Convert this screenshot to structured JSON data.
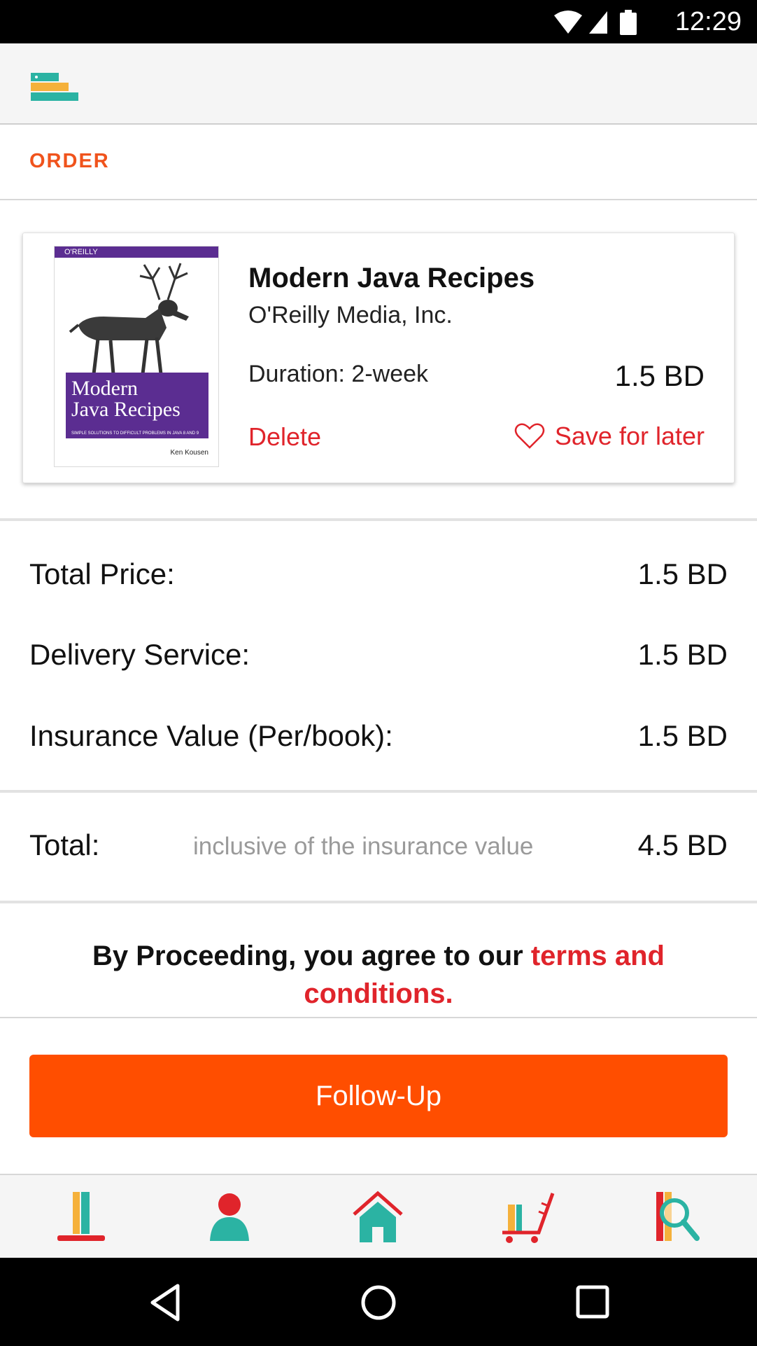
{
  "status_bar": {
    "time": "12:29",
    "icons": [
      "wifi-icon",
      "cell-signal-icon",
      "battery-icon"
    ]
  },
  "app_bar": {
    "menu_icon": "menu-stack-icon"
  },
  "section": {
    "title": "ORDER"
  },
  "order_item": {
    "cover": {
      "brand": "O'REILLY",
      "title_line1": "Modern",
      "title_line2": "Java Recipes",
      "subtitle": "SIMPLE SOLUTIONS TO DIFFICULT PROBLEMS IN JAVA 8 AND 9",
      "author": "Ken Kousen"
    },
    "title": "Modern Java Recipes",
    "publisher": "O'Reilly Media, Inc.",
    "duration": "Duration: 2-week",
    "price": "1.5 BD",
    "delete_label": "Delete",
    "save_label": "Save for later"
  },
  "summary": {
    "total_price_label": "Total Price:",
    "total_price_value": "1.5 BD",
    "delivery_label": "Delivery Service:",
    "delivery_value": "1.5 BD",
    "insurance_label": "Insurance Value (Per/book):",
    "insurance_value": "1.5 BD",
    "total_label": "Total:",
    "total_note": "inclusive of the insurance value",
    "total_value": "4.5 BD"
  },
  "terms": {
    "prefix": "By Proceeding, you agree to our ",
    "link": "terms and conditions."
  },
  "action": {
    "follow_up_label": "Follow-Up"
  },
  "bottom_nav": [
    "books-icon",
    "profile-icon",
    "home-icon",
    "cart-icon",
    "search-books-icon"
  ],
  "colors": {
    "accent": "#ff4e00",
    "link_red": "#e0242b",
    "section_orange": "#f0531c",
    "teal": "#2bb3a3",
    "yellow": "#f5b13b"
  }
}
